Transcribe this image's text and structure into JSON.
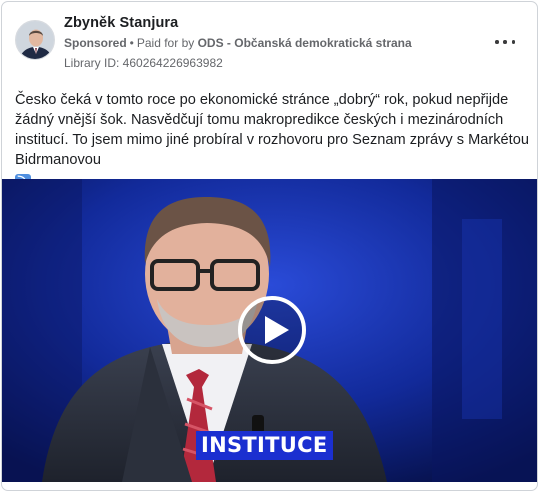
{
  "post": {
    "author": "Zbyněk Stanjura",
    "sponsored": "Sponsored",
    "separator": "•",
    "paid_for_prefix": "Paid for by",
    "payer": "ODS - Občanská demokratická strana",
    "library_id": "Library ID: 460264226963982",
    "text": "Česko čeká v tomto roce po ekonomické stránce „dobrý“ rok, pokud nepřijde žádný vnější šok. Nasvědčují tomu makropredikce českých i mezinárodních institucí. To jsem mimo jiné probíral v rozhovoru pro Seznam zprávy s Markétou Bidrmanovou",
    "emoji": "⤵"
  },
  "video": {
    "caption": "INSTITUCE",
    "play_icon": "play-icon"
  },
  "icons": {
    "more": "more-options-icon",
    "avatar": "avatar"
  },
  "colors": {
    "caption_bg": "#1b2fd0",
    "studio_bg": "#0b1b6a",
    "meta_text": "#65676b"
  }
}
